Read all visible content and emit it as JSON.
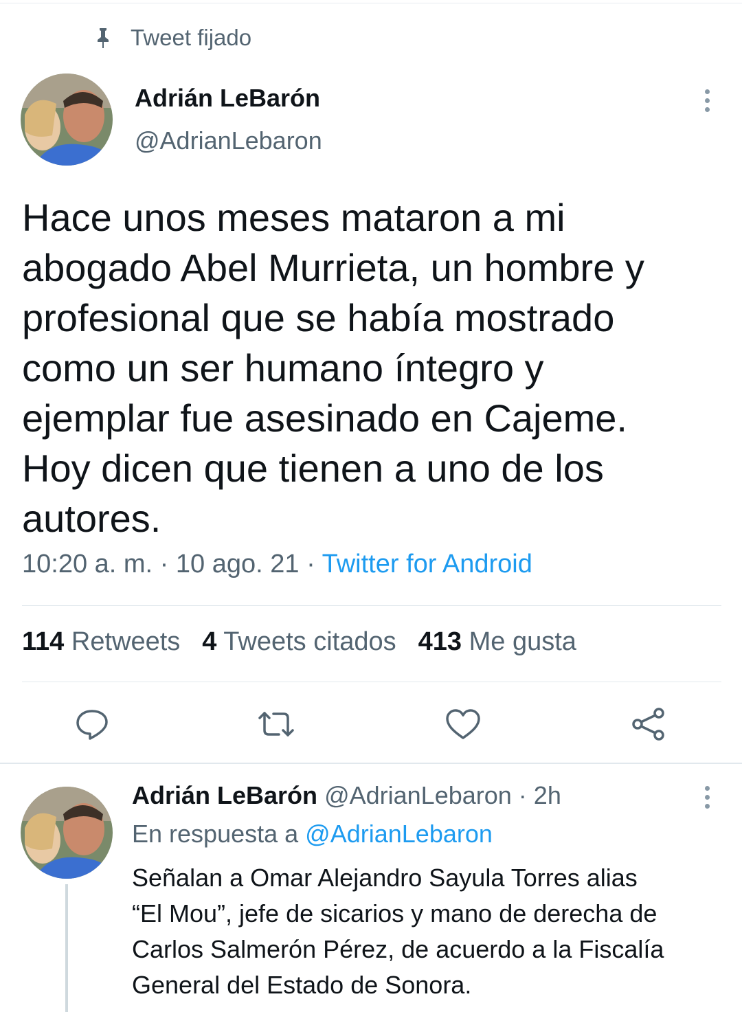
{
  "pinned": {
    "label": "Tweet fijado",
    "icon": "pin-icon"
  },
  "tweet": {
    "author_name": "Adrián LeBarón",
    "author_handle": "@AdrianLebaron",
    "text": "Hace unos meses mataron a mi\nabogado Abel Murrieta, un hombre y\nprofesional que se había mostrado\ncomo un ser humano íntegro y\nejemplar fue asesinado en Cajeme.\nHoy dicen que tienen a uno de los\nautores.",
    "time": "10:20 a. m.",
    "date": "10 ago. 21",
    "separator": " · ",
    "source": "Twitter for Android",
    "stats": {
      "retweets_count": "114",
      "retweets_label": "Retweets",
      "quotes_count": "4",
      "quotes_label": "Tweets citados",
      "likes_count": "413",
      "likes_label": "Me gusta"
    },
    "actions": [
      "reply-icon",
      "retweet-icon",
      "like-icon",
      "share-icon"
    ]
  },
  "reply": {
    "author_name": "Adrián LeBarón",
    "author_handle": "@AdrianLebaron",
    "age": "2h",
    "separator": " · ",
    "reply_prefix": "En respuesta a ",
    "reply_to": "@AdrianLebaron",
    "text": "Señalan a Omar Alejandro Sayula Torres alias\n“El Mou”, jefe de sicarios y mano de derecha de\nCarlos Salmerón Pérez, de acuerdo a la Fiscalía\nGeneral del Estado de Sonora."
  },
  "colors": {
    "text": "#0f1419",
    "secondary": "#536471",
    "link": "#1d9bf0",
    "divider": "#e1e8ed"
  }
}
